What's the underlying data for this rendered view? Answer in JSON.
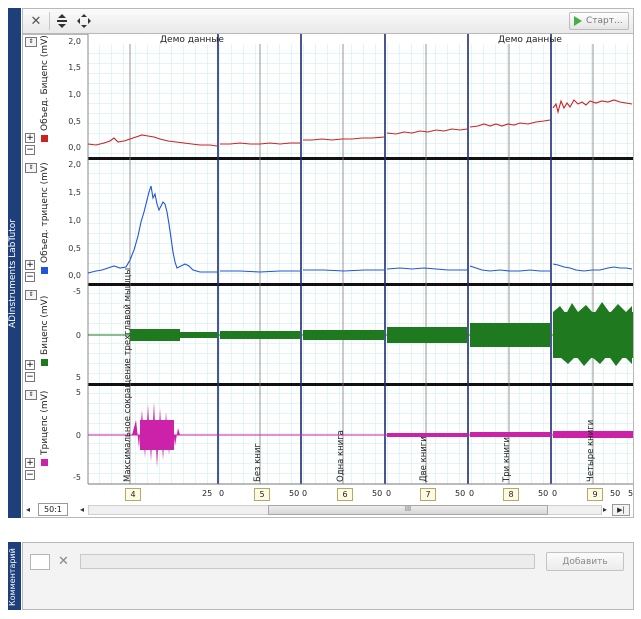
{
  "app": {
    "side_label": "ADInstruments LabTutor"
  },
  "toolbar": {
    "start_label": "Старт..."
  },
  "chart": {
    "section_labels": [
      "Демо данные",
      "Демо данные"
    ],
    "panels": [
      {
        "name": "Объед. Бицепс (mV)",
        "color": "#cc2222",
        "yticks": [
          "2,0",
          "1,5",
          "1,0",
          "0,5",
          "0,0"
        ]
      },
      {
        "name": "Объед. трицепс (mV)",
        "color": "#2255dd",
        "yticks": [
          "2,0",
          "1,5",
          "1,0",
          "0,5",
          "0,0"
        ]
      },
      {
        "name": "Бицепс (mV)",
        "color": "#1f7a1f",
        "yticks": [
          "-5",
          "0",
          "5"
        ]
      },
      {
        "name": "Трицепс (mV)",
        "color": "#cc22aa",
        "yticks": [
          "5",
          "0",
          "-5"
        ]
      }
    ],
    "comments": [
      "Максимальное сокращение трехглавой мышцы",
      "Без книг",
      "Одна книга",
      "Две книги",
      "Три книги",
      "Четыре книги"
    ],
    "block_numbers": [
      "4",
      "5",
      "6",
      "7",
      "8",
      "9"
    ],
    "time_ticks": [
      "25",
      "0",
      "50",
      "0",
      "50",
      "0",
      "50",
      "0",
      "50",
      "0",
      "50",
      "0",
      "5"
    ],
    "zoom": "50:1",
    "scroll_mark": "III"
  },
  "comment_panel": {
    "side_label": "Комментарий",
    "add_label": "Добавить",
    "input_value": ""
  },
  "colors": {
    "frame": "#1f3f7a",
    "grid": "#bfe9ef",
    "divider": "#1f2a7a"
  }
}
